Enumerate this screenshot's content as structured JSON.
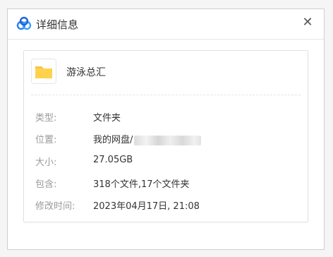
{
  "dialog": {
    "title": "详细信息",
    "close_glyph": "✕"
  },
  "file": {
    "name": "游泳总汇",
    "icon": "folder-icon",
    "folder_color": "#f5c542"
  },
  "details": [
    {
      "label": "类型:",
      "value": "文件夹"
    },
    {
      "label": "位置:",
      "value": "我的网盘/"
    },
    {
      "label": "大小:",
      "value": "27.05GB"
    },
    {
      "label": "包含:",
      "value": "318个文件,17个文件夹"
    },
    {
      "label": "修改时间:",
      "value": "2023年04月17日, 21:08"
    }
  ],
  "colors": {
    "accent_blue": "#2f7cf6",
    "label_gray": "#9a9a9a",
    "text_dark": "#333333"
  }
}
